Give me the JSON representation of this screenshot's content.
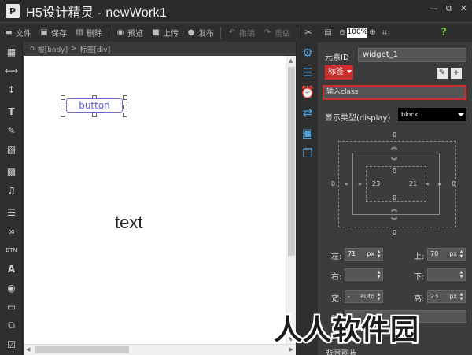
{
  "window": {
    "title": "H5设计精灵 - newWork1",
    "logo_glyph": "P",
    "controls": [
      "—",
      "⧉",
      "✕"
    ]
  },
  "toolbar": {
    "file": "文件",
    "save": "保存",
    "delete": "删除",
    "preview": "预览",
    "upload": "上传",
    "publish": "发布",
    "undo": "撤销",
    "redo": "重做",
    "zoom": "100%",
    "help": "?"
  },
  "breadcrumb": {
    "root": "根[body]",
    "sep": ">",
    "current": "标签[div]"
  },
  "canvas": {
    "button_label": "button",
    "text_label": "text"
  },
  "properties": {
    "element_id_label": "元素ID",
    "element_id_value": "widget_1",
    "tag_label": "标签",
    "class_placeholder": "输入class",
    "display_label": "显示类型(display)",
    "display_value": "block",
    "box": {
      "margin_top": "0",
      "margin_bottom": "0",
      "margin_left": "0",
      "margin_right": "0",
      "padding_top": "0",
      "padding_bottom": "0",
      "padding_left": "23",
      "padding_right": "21"
    },
    "left_label": "左:",
    "left_value": "71",
    "left_unit": "px",
    "top_label": "上:",
    "top_value": "70",
    "top_unit": "px",
    "right_label": "右:",
    "bottom_label": "下:",
    "width_label": "宽:",
    "width_value": "auto",
    "width_prefix": "-",
    "height_label": "高:",
    "height_value": "23",
    "height_unit": "px",
    "motion_label": "动:",
    "bg_label": "背景图片"
  },
  "watermark": "人人软件园",
  "colors": {
    "accent_red": "#c9302c",
    "tab_blue": "#4fa3e0",
    "help_green": "#6cbf3a"
  }
}
